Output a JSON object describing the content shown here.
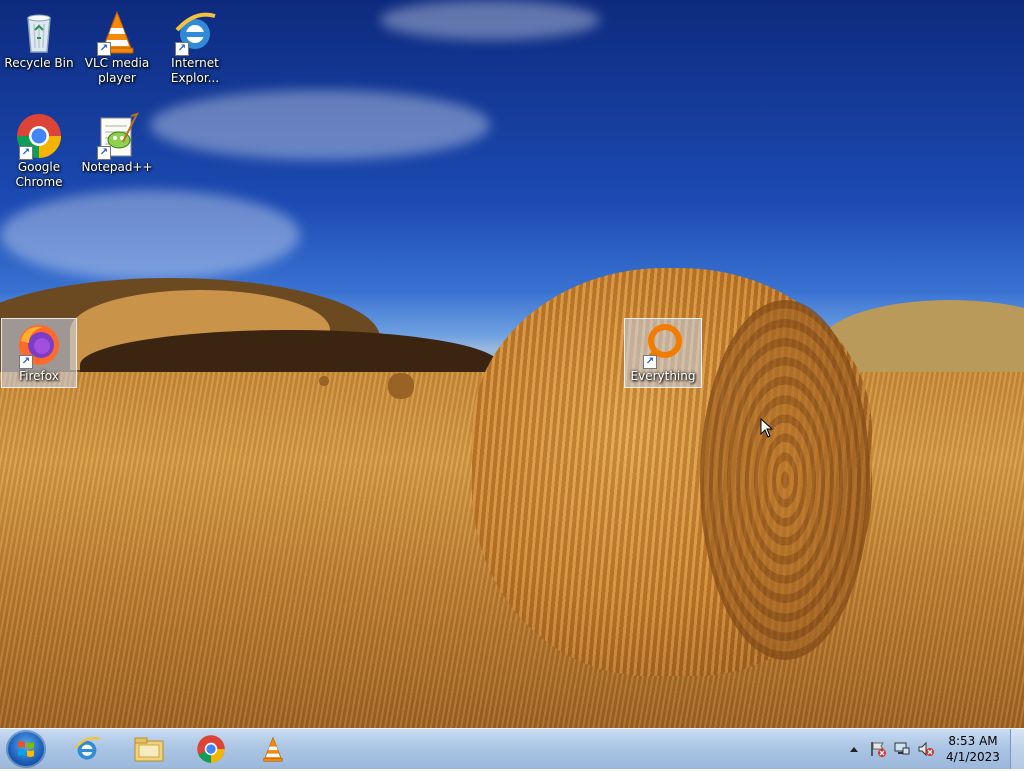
{
  "desktop": {
    "icons": [
      {
        "label": "Recycle Bin",
        "icon": "recycle-bin-icon"
      },
      {
        "label": "VLC media player",
        "icon": "vlc-icon"
      },
      {
        "label": "Internet Explor...",
        "icon": "internet-explorer-icon"
      },
      {
        "label": "Google Chrome",
        "icon": "chrome-icon"
      },
      {
        "label": "Notepad++",
        "icon": "notepad-plus-plus-icon"
      },
      {
        "label": "Firefox",
        "icon": "firefox-icon"
      },
      {
        "label": "Everything",
        "icon": "everything-search-icon"
      }
    ]
  },
  "taskbar": {
    "pinned": [
      {
        "name": "internet-explorer",
        "icon": "internet-explorer-icon"
      },
      {
        "name": "windows-explorer",
        "icon": "folder-icon"
      },
      {
        "name": "google-chrome",
        "icon": "chrome-icon"
      },
      {
        "name": "vlc-media-player",
        "icon": "vlc-icon"
      }
    ],
    "tray": {
      "icons": [
        "show-hidden-icons-icon",
        "action-center-flag-icon",
        "network-icon",
        "volume-muted-icon"
      ]
    },
    "clock": {
      "time": "8:53 AM",
      "date": "4/1/2023"
    }
  },
  "colors": {
    "selection": "#c8d7f0",
    "taskbar": "#a9c3e3",
    "sky": "#1c4bb3",
    "field": "#c88a3a"
  }
}
